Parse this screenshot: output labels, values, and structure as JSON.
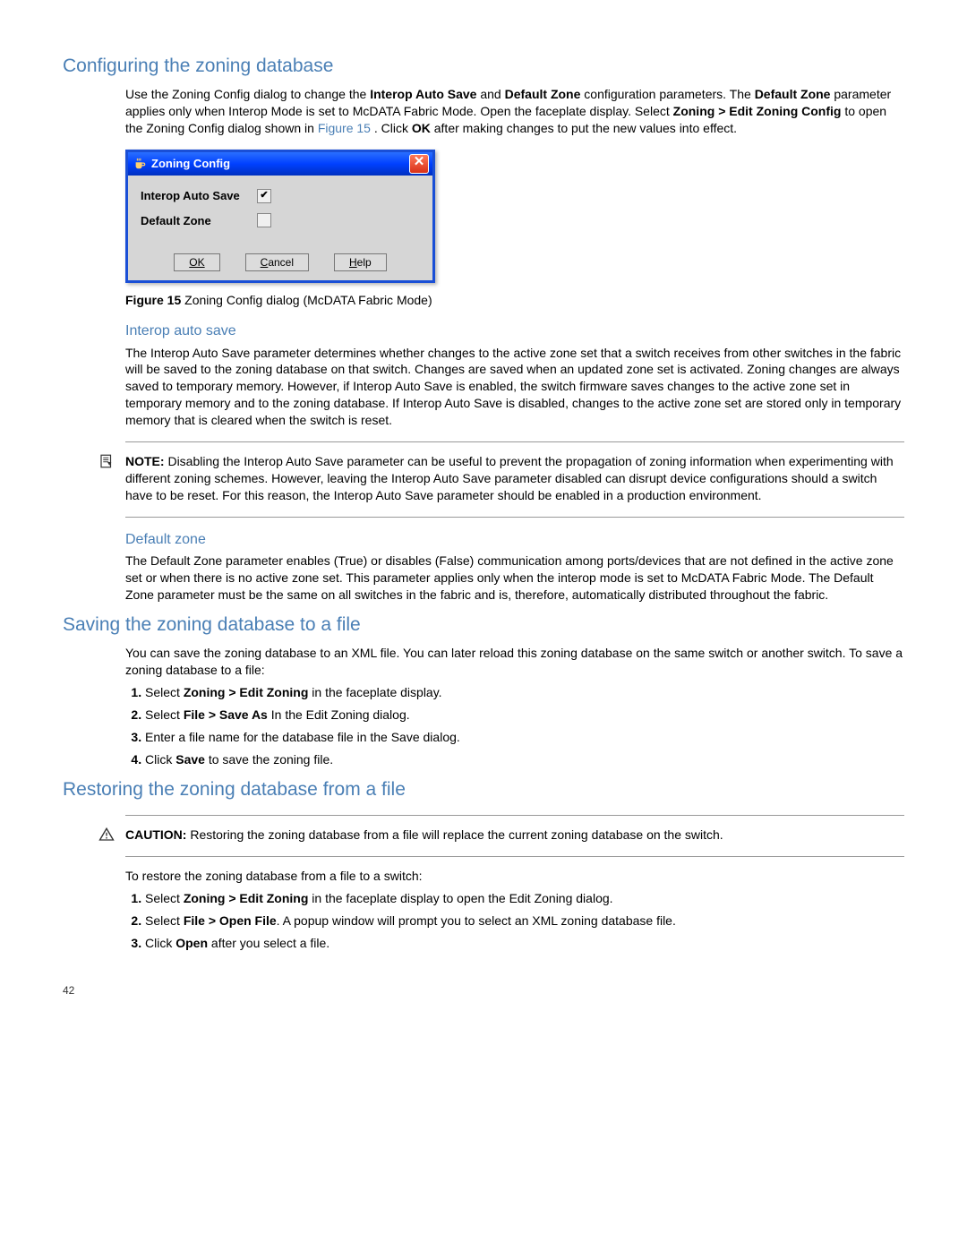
{
  "section1": {
    "title": "Configuring the zoning database",
    "para1a": "Use the Zoning Config dialog to change the ",
    "para1b": " and ",
    "para1c": " configuration parameters. The ",
    "para1d": " parameter applies only when Interop Mode is set to McDATA Fabric Mode. Open the faceplate display. Select ",
    "para1e": " to open the Zoning Config dialog shown in ",
    "para1f": ". Click ",
    "para1g": " after making changes to put the new values into effect.",
    "bold_ias": "Interop Auto Save",
    "bold_dz": "Default Zone",
    "bold_menu": "Zoning > Edit Zoning Config",
    "bold_ok": "OK",
    "figlink": "Figure 15"
  },
  "dialog": {
    "title": "Zoning Config",
    "row1": "Interop Auto Save",
    "row2": "Default Zone",
    "ok": "OK",
    "cancel": "Cancel",
    "help": "Help",
    "ias_checked": true,
    "dz_checked": false
  },
  "figcaption": {
    "label": "Figure 15",
    "text": "  Zoning Config dialog (McDATA Fabric Mode)"
  },
  "sub_ias": {
    "title": "Interop auto save",
    "para": "The Interop Auto Save parameter determines whether changes to the active zone set that a switch receives from other switches in the fabric will be saved to the zoning database on that switch. Changes are saved when an updated zone set is activated. Zoning changes are always saved to temporary memory. However, if Interop Auto Save is enabled, the switch firmware saves changes to the active zone set in temporary memory and to the zoning database. If Interop Auto Save is disabled, changes to the active zone set are stored only in temporary memory that is cleared when the switch is reset."
  },
  "note": {
    "label": "NOTE:",
    "text": "   Disabling the Interop Auto Save parameter can be useful to prevent the propagation of zoning information when experimenting with different zoning schemes. However, leaving the Interop Auto Save parameter disabled can disrupt device configurations should a switch have to be reset. For this reason, the Interop Auto Save parameter should be enabled in a production environment."
  },
  "sub_dz": {
    "title": "Default zone",
    "para": "The Default Zone parameter enables (True) or disables (False) communication among ports/devices that are not defined in the active zone set or when there is no active zone set. This parameter applies only when the interop mode is set to McDATA Fabric Mode. The Default Zone parameter must be the same on all switches in the fabric and is, therefore, automatically distributed throughout the fabric."
  },
  "section2": {
    "title": "Saving the zoning database to a file",
    "para": "You can save the zoning database to an XML file. You can later reload this zoning database on the same switch or another switch. To save a zoning database to a file:",
    "steps": [
      {
        "pre": "Select ",
        "b": "Zoning > Edit Zoning",
        "post": " in the faceplate display."
      },
      {
        "pre": "Select ",
        "b": "File > Save As",
        "post": " In the Edit Zoning dialog."
      },
      {
        "pre": "Enter a file name for the database file in the Save dialog.",
        "b": "",
        "post": ""
      },
      {
        "pre": "Click ",
        "b": "Save",
        "post": " to save the zoning file."
      }
    ]
  },
  "section3": {
    "title": "Restoring the zoning database from a file",
    "caution_label": "CAUTION:",
    "caution_text": "   Restoring the zoning database from a file will replace the current zoning database on the switch.",
    "para": "To restore the zoning database from a file to a switch:",
    "steps": [
      {
        "pre": "Select ",
        "b": "Zoning > Edit Zoning",
        "post": " in the faceplate display to open the Edit Zoning dialog."
      },
      {
        "pre": "Select ",
        "b": "File > Open File",
        "post": ". A popup window will prompt you to select an XML zoning database file."
      },
      {
        "pre": "Click ",
        "b": "Open",
        "post": " after you select a file."
      }
    ]
  },
  "pagenum": "42"
}
